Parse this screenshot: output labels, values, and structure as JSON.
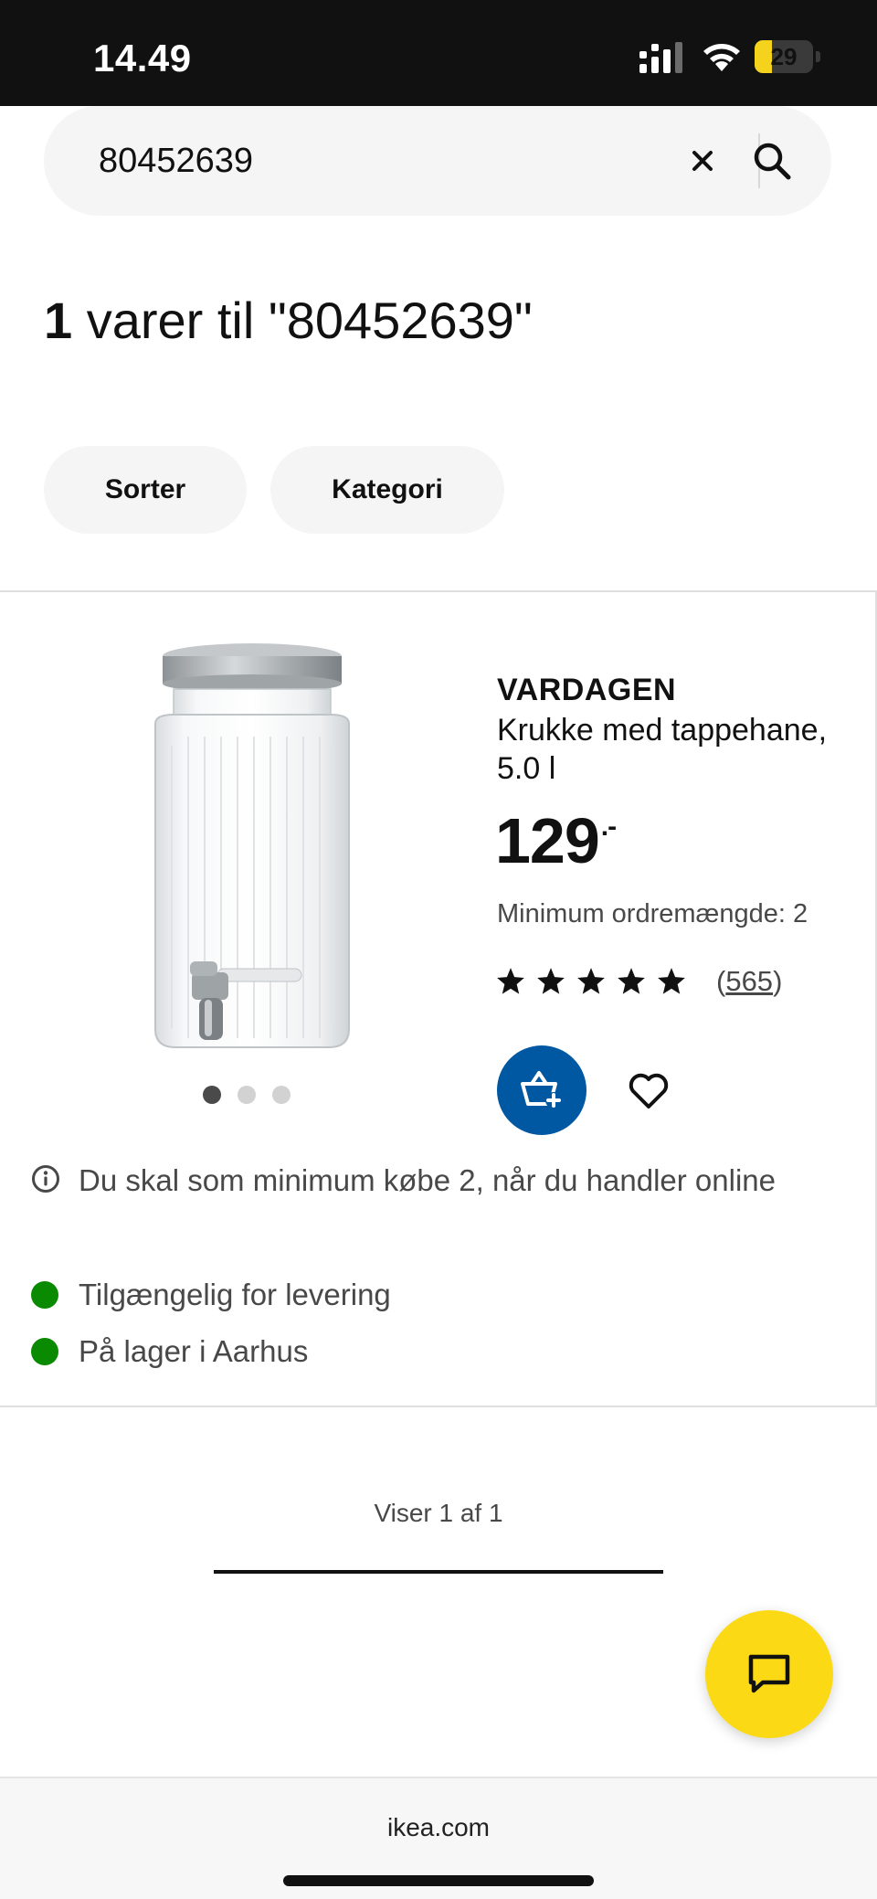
{
  "status_bar": {
    "time": "14.49",
    "battery_level": "29",
    "battery_fraction": 0.29
  },
  "search": {
    "value": "80452639",
    "placeholder": "",
    "clear_icon": "close-icon",
    "search_icon": "search-icon"
  },
  "results": {
    "count": "1",
    "label": " varer til \"80452639\""
  },
  "filters": [
    {
      "label": "Sorter"
    },
    {
      "label": "Kategori"
    }
  ],
  "product": {
    "brand": "VARDAGEN",
    "description": "Krukke med tappehane, 5.0 l",
    "price": "129",
    "price_suffix": ".-",
    "min_order": "Minimum ordremængde: 2",
    "rating_stars": 4.5,
    "rating_max": 5,
    "review_count": "565",
    "image_count": 3,
    "active_image": 1,
    "notice": "Du skal som minimum købe 2, når du handler online",
    "availability": [
      {
        "text": "Tilgængelig for levering",
        "status_color": "#0a8a00"
      },
      {
        "text": "På lager i Aarhus",
        "status_color": "#0a8a00"
      }
    ]
  },
  "pagination": {
    "text": "Viser 1 af 1",
    "progress": 1.0
  },
  "browser": {
    "url": "ikea.com"
  },
  "colors": {
    "brand_blue": "#0058a3",
    "chat_yellow": "#fbd914",
    "available_green": "#0a8a00"
  }
}
